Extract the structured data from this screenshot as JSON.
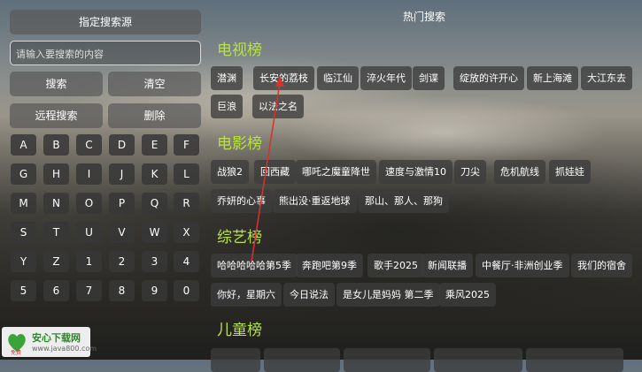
{
  "left_panel": {
    "source_button": "指定搜索源",
    "search_placeholder": "请输入要搜索的内容",
    "search_button": "搜索",
    "clear_button": "清空",
    "remote_search_button": "远程搜索",
    "delete_button": "删除",
    "keys": [
      "A",
      "B",
      "C",
      "D",
      "E",
      "F",
      "G",
      "H",
      "I",
      "J",
      "K",
      "L",
      "M",
      "N",
      "O",
      "P",
      "Q",
      "R",
      "S",
      "T",
      "U",
      "V",
      "W",
      "X",
      "Y",
      "Z",
      "1",
      "2",
      "3",
      "4",
      "5",
      "6",
      "7",
      "8",
      "9",
      "0"
    ]
  },
  "right_panel": {
    "title": "热门搜索",
    "categories": {
      "tv": {
        "label": "电视榜",
        "items": [
          "潜渊",
          "长安的荔枝",
          "临江仙",
          "淬火年代",
          "剑谍",
          "绽放的许开心",
          "新上海滩",
          "大江东去",
          "巨浪",
          "以法之名"
        ]
      },
      "movie": {
        "label": "电影榜",
        "items": [
          "战狼2",
          "回西藏",
          "哪吒之魔童降世",
          "速度与激情10",
          "刀尖",
          "危机航线",
          "抓娃娃",
          "乔妍的心事",
          "熊出没·重返地球",
          "那山、那人、那狗"
        ]
      },
      "variety": {
        "label": "综艺榜",
        "items": [
          "哈哈哈哈哈第5季",
          "奔跑吧第9季",
          "歌手2025",
          "新闻联播",
          "中餐厅·非洲创业季",
          "我们的宿舍",
          "你好，星期六",
          "今日说法",
          "是女儿是妈妈 第二季",
          "乘风2025"
        ]
      },
      "kids": {
        "label": "儿童榜"
      }
    }
  },
  "watermark": {
    "name": "安心下载网",
    "url": "www.java800.com",
    "sub": "免费"
  },
  "colors": {
    "category_green": "#b8e24a",
    "arrow_red": "#d9322b"
  }
}
